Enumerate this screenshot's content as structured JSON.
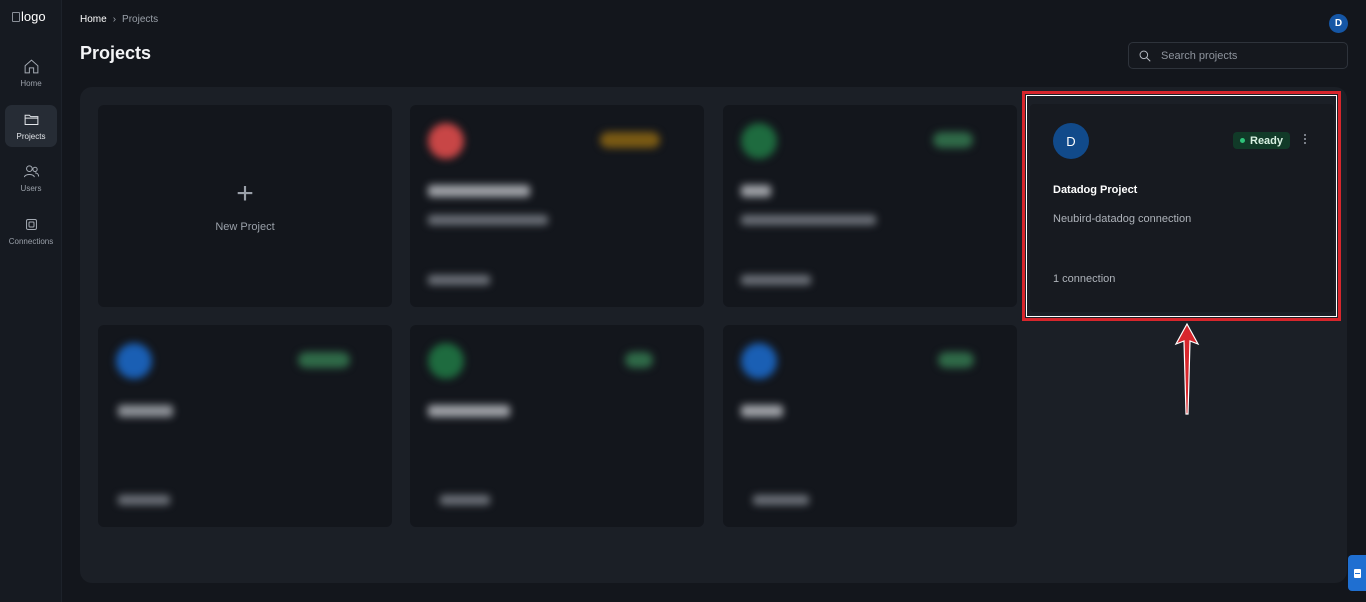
{
  "sidebar": {
    "logo_alt": "logo",
    "items": [
      {
        "label": "Home",
        "icon": "home-icon"
      },
      {
        "label": "Projects",
        "icon": "folder-icon",
        "active": true
      },
      {
        "label": "Users",
        "icon": "users-icon"
      },
      {
        "label": "Connections",
        "icon": "chip-icon"
      }
    ]
  },
  "breadcrumb": {
    "home": "Home",
    "current": "Projects"
  },
  "page_title": "Projects",
  "user_avatar": "D",
  "search": {
    "placeholder": "Search projects"
  },
  "new_project": {
    "label": "New Project"
  },
  "project_card": {
    "avatar": "D",
    "status": "Ready",
    "title": "Datadog Project",
    "description": "Neubird-datadog connection",
    "connections": "1 connection"
  },
  "colors": {
    "accent_blue": "#1556a5",
    "status_green": "#2fc27a",
    "highlight_red": "#d7262c"
  }
}
